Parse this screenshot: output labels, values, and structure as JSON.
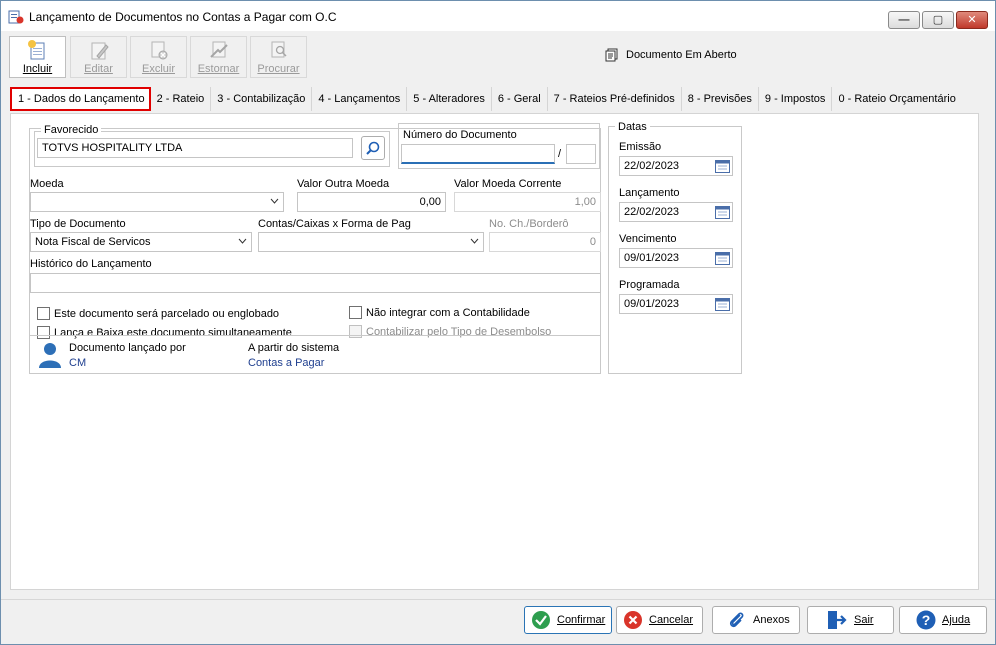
{
  "window": {
    "title": "Lançamento de Documentos no Contas a Pagar com O.C",
    "minimize_glyph": "—",
    "maximize_glyph": "▢",
    "close_glyph": "✕"
  },
  "toolbar": {
    "buttons": [
      {
        "label": "Incluir",
        "icon": "new-document-icon",
        "enabled": true
      },
      {
        "label": "Editar",
        "icon": "edit-icon",
        "enabled": false
      },
      {
        "label": "Excluir",
        "icon": "delete-icon",
        "enabled": false
      },
      {
        "label": "Estornar",
        "icon": "reverse-icon",
        "enabled": false
      },
      {
        "label": "Procurar",
        "icon": "search-document-icon",
        "enabled": false
      }
    ],
    "status": "Documento Em Aberto"
  },
  "tabs": [
    "1 - Dados do Lançamento",
    "2 - Rateio",
    "3 - Contabilização",
    "4 - Lançamentos",
    "5 - Alteradores",
    "6 - Geral",
    "7 - Rateios Pré-definidos",
    "8 - Previsões",
    "9 - Impostos",
    "0 - Rateio Orçamentário"
  ],
  "form": {
    "favorecido_label": "Favorecido",
    "favorecido_value": "TOTVS HOSPITALITY LTDA",
    "numero_label": "Número do Documento",
    "numero_value": "",
    "numero_sep": "/",
    "numero_suffix": "",
    "moeda_label": "Moeda",
    "moeda_value": "",
    "valor_outra_label": "Valor Outra Moeda",
    "valor_outra_value": "0,00",
    "valor_corrente_label": "Valor Moeda Corrente",
    "valor_corrente_value": "1,00",
    "tipo_label": "Tipo de Documento",
    "tipo_value": "Nota Fiscal de Servicos",
    "contas_label": "Contas/Caixas x Forma de Pag",
    "contas_value": "",
    "bordero_label": "No. Ch./Borderô",
    "bordero_value": "0",
    "historico_label": "Histórico do Lançamento",
    "historico_value": "",
    "checks": {
      "parcelado": "Este documento será parcelado ou englobado",
      "lanca_baixa": "Lança e Baixa este documento simultaneamente",
      "nao_integrar": "Não integrar com a Contabilidade",
      "contabilizar": "Contabilizar pelo Tipo de Desembolso"
    },
    "lancado_por_label": "Documento lançado por",
    "lancado_por_value": "CM",
    "sistema_label": "A partir do sistema",
    "sistema_value": "Contas a Pagar"
  },
  "datas": {
    "title": "Datas",
    "emissao_label": "Emissão",
    "emissao_value": "22/02/2023",
    "lancamento_label": "Lançamento",
    "lancamento_value": "22/02/2023",
    "vencimento_label": "Vencimento",
    "vencimento_value": "09/01/2023",
    "programada_label": "Programada",
    "programada_value": "09/01/2023"
  },
  "bottom_buttons": {
    "confirmar": "Confirmar",
    "cancelar": "Cancelar",
    "anexos": "Anexos",
    "sair": "Sair",
    "ajuda": "Ajuda"
  },
  "colors": {
    "active_tab_border": "#e00000",
    "focus_blue": "#2a6fb5",
    "confirm_green": "#2e9e4f",
    "cancel_red": "#d9352b",
    "help_blue": "#1f5fb5"
  }
}
